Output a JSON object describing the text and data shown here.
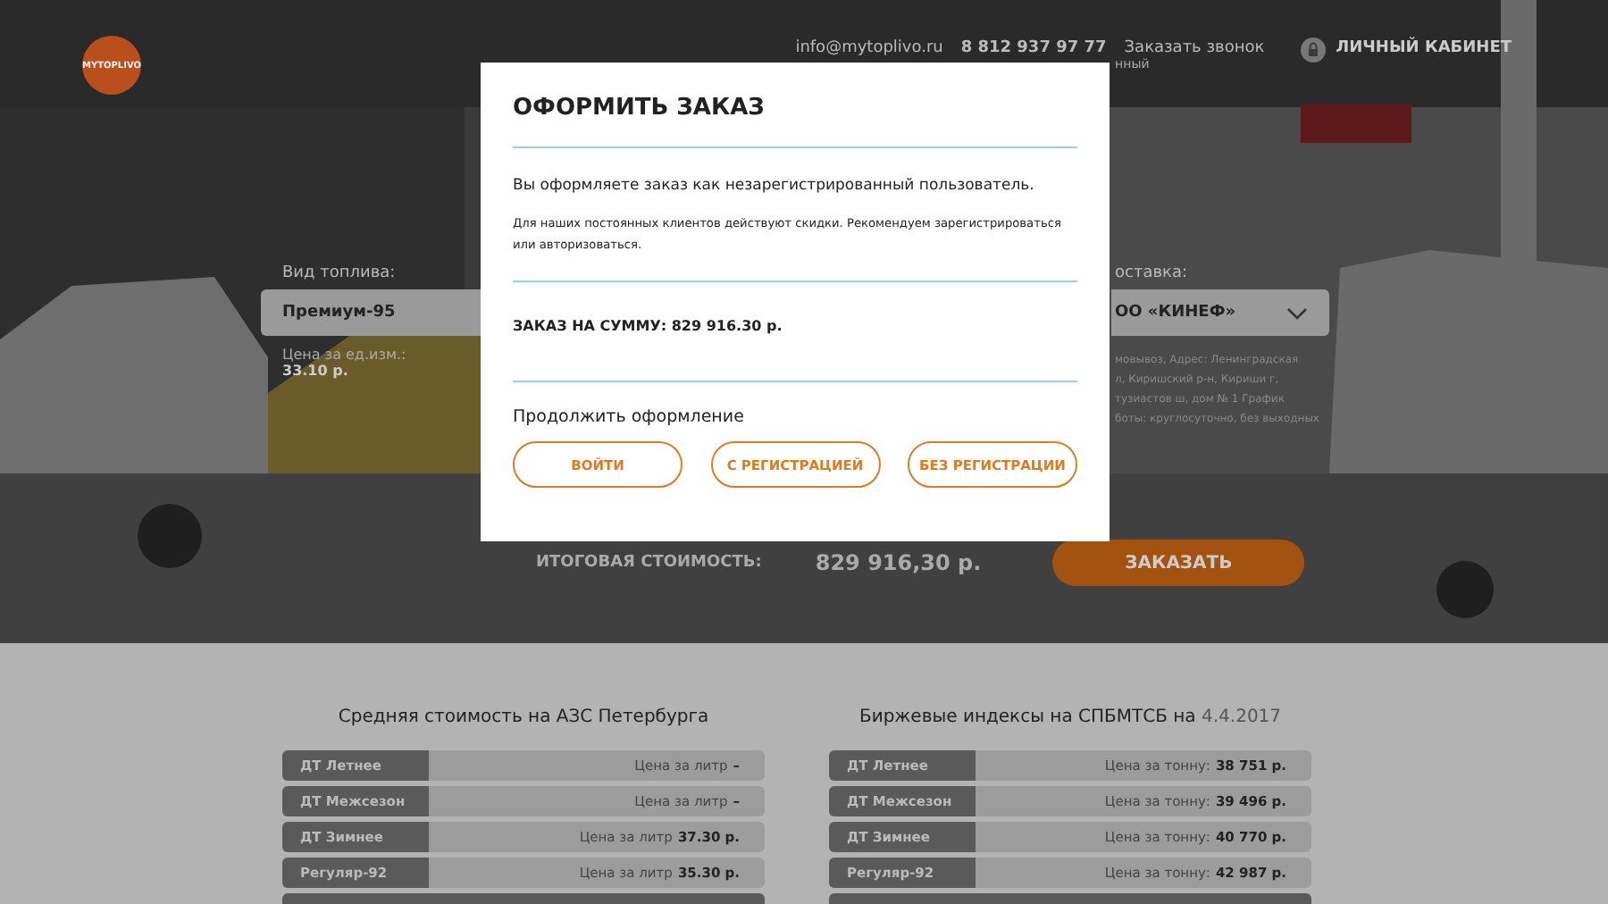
{
  "header": {
    "logo_text": "MYTOPLIVO",
    "email": "info@mytoplivo.ru",
    "phone": "8 812 937 97 77",
    "phone_note": "нный",
    "callback": "Заказать звонок",
    "account": "ЛИЧНЫЙ КАБИНЕТ"
  },
  "order_form": {
    "fuel_label": "Вид топлива:",
    "fuel_value": "Премиум-95",
    "unit_price_label": "Цена за ед.изм.:",
    "unit_price": "33.10 р.",
    "delivery_label": "оставка:",
    "delivery_value": "ОО «КИНЕФ»",
    "delivery_address": [
      "мовывоз, Адрес: Ленинградская",
      "л, Киришский р-н, Кириши г,",
      "тузиастов ш, дом № 1 График",
      "боты: круглосуточно, без выходных"
    ],
    "total_label": "ИТОГОВАЯ СТОИМОСТЬ:",
    "total_value": "829 916,30 р.",
    "order_button": "ЗАКАЗАТЬ"
  },
  "modal": {
    "title": "ОФОРМИТЬ ЗАКАЗ",
    "message": "Вы оформляете заказ как незарегистрированный пользователь.",
    "note": "Для наших постоянных клиентов действуют скидки. Рекомендуем зарегистрироваться или авторизоваться.",
    "sum": "ЗАКАЗ НА СУММУ: 829 916.30 р.",
    "continue_label": "Продолжить оформление",
    "buttons": [
      "ВОЙТИ",
      "С РЕГИСТРАЦИЕЙ",
      "БЕЗ РЕГИСТРАЦИИ"
    ]
  },
  "tables": [
    {
      "title": "Средняя стоимость на АЗС Петербурга",
      "rows": [
        {
          "name": "ДТ Летнее",
          "price_label": "Цена за литр",
          "price": "–"
        },
        {
          "name": "ДТ Межсезон",
          "price_label": "Цена за литр",
          "price": "–"
        },
        {
          "name": "ДТ Зимнее",
          "price_label": "Цена за литр",
          "price": "37.30 р."
        },
        {
          "name": "Регуляр-92",
          "price_label": "Цена за литр",
          "price": "35.30 р."
        }
      ]
    },
    {
      "title": "Биржевые индексы на СПБМТСБ на",
      "date": "4.4.2017",
      "rows": [
        {
          "name": "ДТ Летнее",
          "price_label": "Цена за тонну:",
          "price": "38 751 р."
        },
        {
          "name": "ДТ Межсезон",
          "price_label": "Цена за тонну:",
          "price": "39 496 р."
        },
        {
          "name": "ДТ Зимнее",
          "price_label": "Цена за тонну:",
          "price": "40 770 р."
        },
        {
          "name": "Регуляр-92",
          "price_label": "Цена за тонну:",
          "price": "42 987 р."
        }
      ]
    }
  ]
}
